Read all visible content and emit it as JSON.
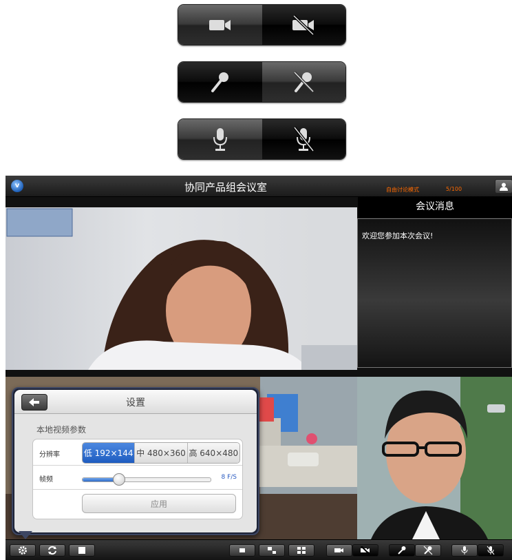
{
  "toggles": [
    {
      "name": "camera-toggle",
      "on_icon": "video-camera-icon",
      "off_icon": "video-camera-off-icon"
    },
    {
      "name": "mic-toggle",
      "on_icon": "handheld-mic-icon",
      "off_icon": "handheld-mic-off-icon"
    },
    {
      "name": "desk-mic-toggle",
      "on_icon": "desk-mic-icon",
      "off_icon": "desk-mic-off-icon"
    }
  ],
  "topbar": {
    "title": "协同产品组会议室",
    "mode": "自由讨论模式",
    "count": "5/100"
  },
  "messages": {
    "header": "会议消息",
    "welcome": "欢迎您参加本次会议!"
  },
  "settings": {
    "title": "设置",
    "section": "本地视频参数",
    "resolution_label": "分辨率",
    "resolution_options": [
      "低 192×144",
      "中 480×360",
      "高 640×480"
    ],
    "selected_resolution": "低 192×144",
    "framerate_label": "帧频",
    "framerate_value": "8 F/S",
    "framerate_fraction": 0.28,
    "apply_label": "应用"
  },
  "bottombar": {
    "icons": [
      "gear-icon",
      "refresh-icon",
      "stop-icon",
      "layout-single-icon",
      "layout-pip-icon",
      "layout-grid-icon",
      "video-camera-icon",
      "video-camera-off-icon",
      "handheld-mic-icon",
      "handheld-mic-off-icon",
      "desk-mic-icon",
      "desk-mic-off-icon"
    ]
  },
  "colors": {
    "mode_text": "#ff6a00",
    "accent_blue": "#2f6bc7"
  }
}
